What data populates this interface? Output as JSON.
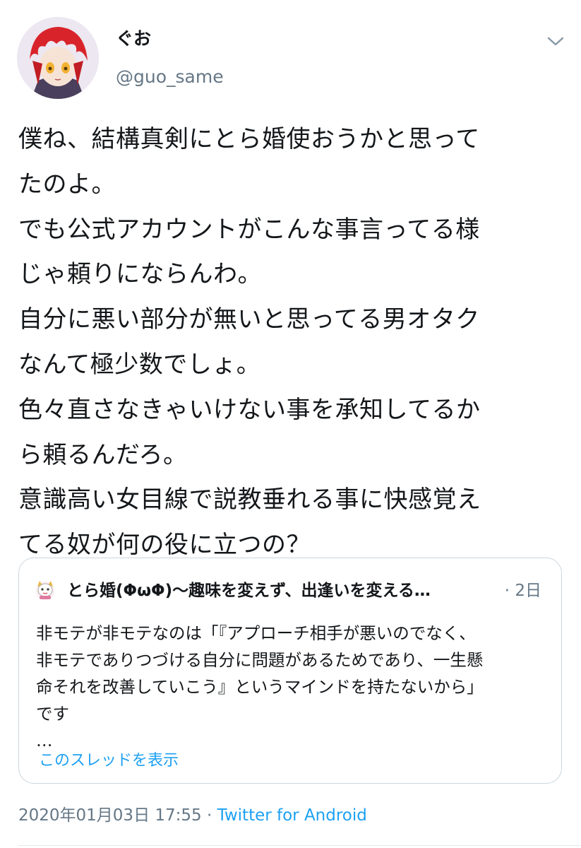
{
  "tweet": {
    "display_name": "ぐお",
    "handle": "@guo_same",
    "lines": [
      "僕ね、結構真剣にとら婚使おうかと思って",
      "たのよ。",
      "でも公式アカウントがこんな事言ってる様",
      "じゃ頼りにならんわ。",
      "自分に悪い部分が無いと思ってる男オタク",
      "なんて極少数でしょ。",
      "色々直さなきゃいけない事を承知してるか",
      "ら頼るんだろ。",
      "意識高い女目線で説教垂れる事に快感覚え",
      "てる奴が何の役に立つの？"
    ],
    "timestamp": "2020年01月03日 17:55",
    "separator": "·",
    "source": "Twitter for Android"
  },
  "quoted": {
    "name": "とら婚(ΦωΦ)〜趣味を変えず、出逢いを変える…",
    "time": "· 2日",
    "lines": [
      "非モテが非モテなのは「『アプローチ相手が悪いのでなく、",
      "非モテでありつづける自分に問題があるためであり、一生懸",
      "命それを改善していこう』というマインドを持たないから」",
      "です",
      "…"
    ],
    "show_thread": "このスレッドを表示"
  },
  "icons": {
    "more": "chevron-down-icon",
    "avatar": "user-avatar",
    "quoted_avatar": "cat-mascot-avatar"
  },
  "colors": {
    "text": "#14171a",
    "secondary": "#657786",
    "link": "#1da1f2",
    "border": "#ccd6dd"
  }
}
